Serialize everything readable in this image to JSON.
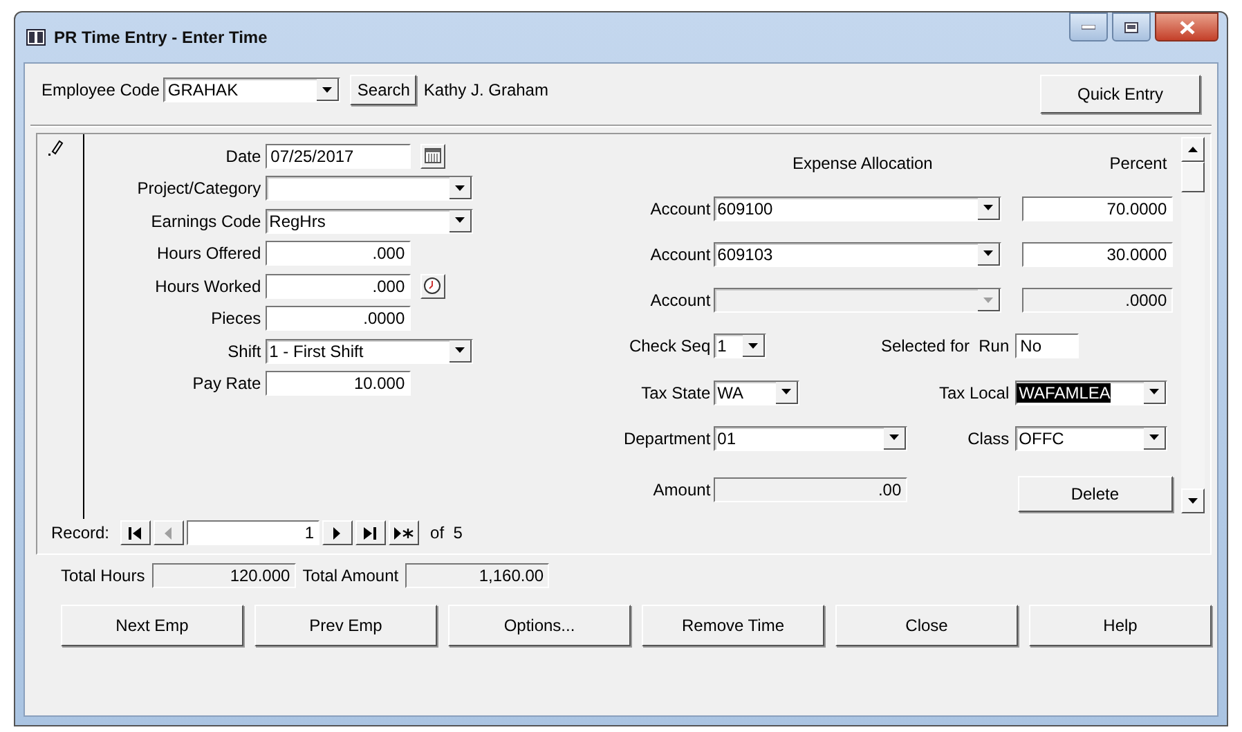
{
  "window": {
    "title": "PR Time Entry - Enter Time"
  },
  "employee": {
    "label": "Employee Code",
    "value": "GRAHAK",
    "search_button": "Search",
    "name": "Kathy J. Graham"
  },
  "quick_entry_button": "Quick Entry",
  "left_fields": [
    {
      "label": "Date",
      "value": "07/25/2017",
      "kind": "date"
    },
    {
      "label": "Project/Category",
      "kind": "combo"
    },
    {
      "label": "Earnings Code",
      "value": "RegHrs",
      "kind": "combo"
    },
    {
      "label": "Hours Offered",
      "value": ".000",
      "kind": "number"
    },
    {
      "label": "Hours Worked",
      "value": ".000",
      "kind": "clock"
    },
    {
      "label": "Pieces",
      "value": ".0000",
      "kind": "number"
    },
    {
      "label": "Shift",
      "value": "1 - First Shift",
      "kind": "combo"
    },
    {
      "label": "Pay Rate",
      "value": "10.000",
      "kind": "number"
    }
  ],
  "expense": {
    "header": "Expense Allocation",
    "percent_header": "Percent",
    "accounts": [
      {
        "label": "Account",
        "value": "609100",
        "percent": "70.0000",
        "disabled": false
      },
      {
        "label": "Account",
        "value": "609103",
        "percent": "30.0000",
        "disabled": false
      },
      {
        "label": "Account",
        "percent": ".0000",
        "disabled": true
      }
    ]
  },
  "check_seq": {
    "label": "Check Seq",
    "value": "1"
  },
  "selected_for_run": {
    "label": "Selected for  Run",
    "value": "No"
  },
  "tax_state": {
    "label": "Tax State",
    "value": "WA"
  },
  "tax_local": {
    "label": "Tax Local",
    "value": "WAFAMLEA",
    "selected": true
  },
  "department": {
    "label": "Department",
    "value": "01"
  },
  "class": {
    "label": "Class",
    "value": "OFFC"
  },
  "amount": {
    "label": "Amount",
    "value": ".00",
    "disabled": true
  },
  "delete_button": "Delete",
  "record": {
    "label": "Record:",
    "value": "1",
    "of_text": "of  5"
  },
  "totals": [
    {
      "label": "Total Hours",
      "value": "120.000"
    },
    {
      "label": "Total Amount",
      "value": "1,160.00"
    }
  ],
  "buttons": [
    "Next Emp",
    "Prev Emp",
    "Options...",
    "Remove Time",
    "Close",
    "Help"
  ]
}
